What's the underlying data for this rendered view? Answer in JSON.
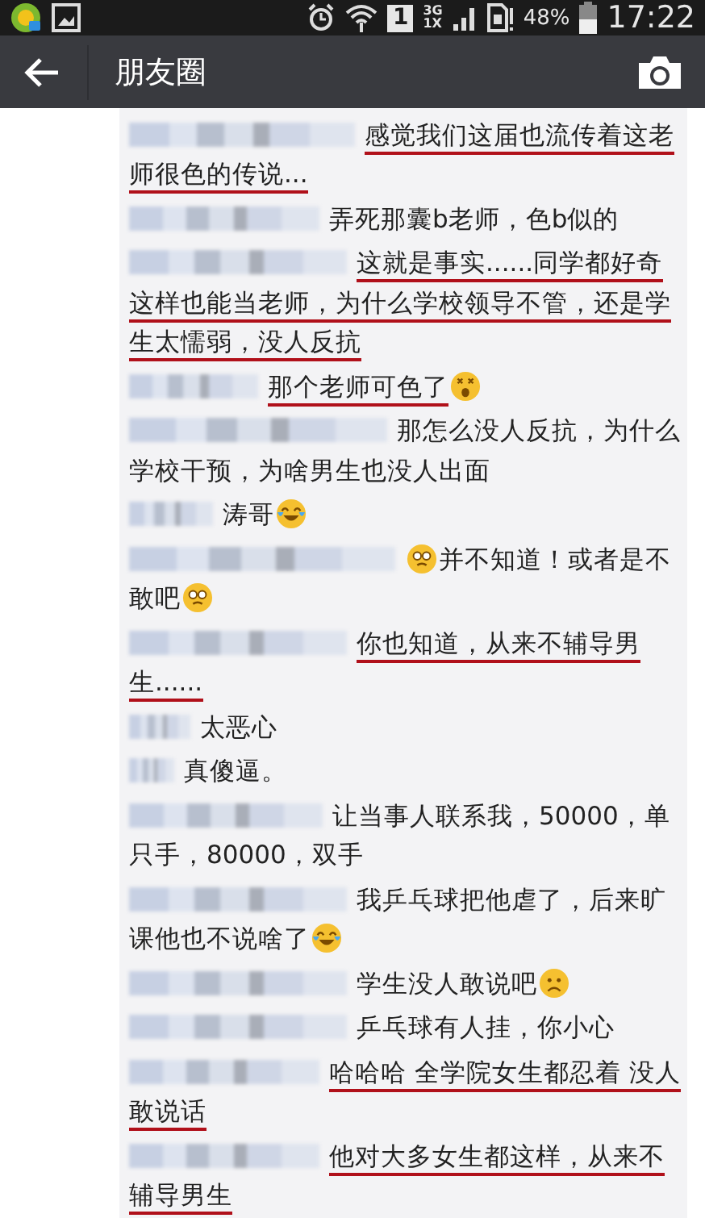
{
  "status_bar": {
    "sim_slot": "1",
    "network_top": "3G",
    "network_bottom": "1X",
    "battery": "48%",
    "time": "17:22"
  },
  "header": {
    "title": "朋友圈"
  },
  "comments": [
    {
      "underlined": true,
      "parts": [
        {
          "kind": "text",
          "text": "感觉我们这届也流传着这老师很色的传说..."
        }
      ]
    },
    {
      "underlined": false,
      "parts": [
        {
          "kind": "text",
          "text": "弄死那囊b老师，色b似的"
        }
      ]
    },
    {
      "underlined": true,
      "parts": [
        {
          "kind": "text",
          "text": "这就是事实......同学都好奇这样也能当老师，为什么学校领导不管，还是学生太懦弱，没人反抗"
        }
      ]
    },
    {
      "underlined": true,
      "parts": [
        {
          "kind": "text",
          "text": "那个老师可色了"
        },
        {
          "kind": "dizzy"
        }
      ]
    },
    {
      "underlined": false,
      "parts": [
        {
          "kind": "text",
          "text": "那怎么没人反抗，为什么学校干预，为啥男生也没人出面"
        }
      ]
    },
    {
      "underlined": false,
      "parts": [
        {
          "kind": "text",
          "text": "涛哥"
        },
        {
          "kind": "laughcry"
        }
      ]
    },
    {
      "underlined": false,
      "parts": [
        {
          "kind": "awkward"
        },
        {
          "kind": "text",
          "text": "并不知道！或者是不敢吧"
        },
        {
          "kind": "awkward"
        }
      ]
    },
    {
      "underlined": true,
      "parts": [
        {
          "kind": "text",
          "text": "你也知道，从来不辅导男生......"
        }
      ]
    },
    {
      "underlined": false,
      "parts": [
        {
          "kind": "text",
          "text": "太恶心"
        }
      ]
    },
    {
      "underlined": false,
      "parts": [
        {
          "kind": "text",
          "text": "真傻逼。"
        }
      ]
    },
    {
      "underlined": false,
      "parts": [
        {
          "kind": "text",
          "text": "让当事人联系我，50000，单只手，80000，双手"
        }
      ]
    },
    {
      "underlined": false,
      "parts": [
        {
          "kind": "text",
          "text": "我乒乓球把他虐了，后来旷课他也不说啥了"
        },
        {
          "kind": "laughcry"
        }
      ]
    },
    {
      "underlined": false,
      "parts": [
        {
          "kind": "text",
          "text": "学生没人敢说吧"
        },
        {
          "kind": "sad"
        }
      ]
    },
    {
      "underlined": false,
      "parts": [
        {
          "kind": "text",
          "text": "乒乓球有人挂，你小心"
        }
      ]
    },
    {
      "underlined": true,
      "parts": [
        {
          "kind": "text",
          "text": "哈哈哈 全学院女生都忍着 没人敢说话"
        }
      ]
    },
    {
      "underlined": true,
      "parts": [
        {
          "kind": "text",
          "text": "他对大多女生都这样，从来不辅导男生"
        }
      ]
    }
  ]
}
